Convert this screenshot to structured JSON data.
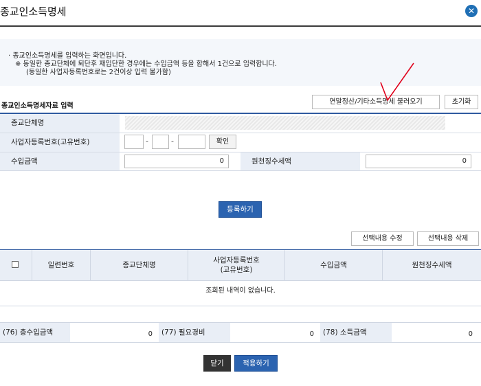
{
  "dialog": {
    "title": "종교인소득명세",
    "close_icon": "close-icon"
  },
  "notice": {
    "line1": "· 종교인소득명세를 입력하는 화면입니다.",
    "line2": "※ 동일한 종교단체에 퇴단후 재입단한 경우에는 수입금액 등을 합해서 1건으로 입력합니다.",
    "line3": "(동일한 사업자등록번호로는 2건이상 입력 불가함)"
  },
  "toolbar": {
    "load_label": "연말정산/기타소득명세 불러오기",
    "reset_label": "초기화"
  },
  "form": {
    "section_title": "종교인소득명세자료 입력",
    "org_name_label": "종교단체명",
    "bizno_label": "사업자등록번호(고유번호)",
    "confirm_label": "확인",
    "income_label": "수입금액",
    "income_value": "0",
    "withholding_label": "원천징수세액",
    "withholding_value": "0"
  },
  "register_label": "등록하기",
  "list_actions": {
    "edit_label": "선택내용 수정",
    "delete_label": "선택내용 삭제"
  },
  "grid": {
    "columns": [
      "일련번호",
      "종교단체명",
      "사업자등록번호",
      "(고유번호)",
      "수입금액",
      "원천징수세액"
    ],
    "empty_message": "조회된 내역이 없습니다."
  },
  "summary": {
    "total_income_label": "(76) 총수입금액",
    "total_income_value": "0",
    "expense_label": "(77) 필요경비",
    "expense_value": "0",
    "income_amount_label": "(78) 소득금액",
    "income_amount_value": "0"
  },
  "footer": {
    "close_label": "닫기",
    "apply_label": "적용하기"
  },
  "colors": {
    "primary": "#2b63b0",
    "header_bg": "#e9eef6",
    "annotation": "#e0001b"
  }
}
